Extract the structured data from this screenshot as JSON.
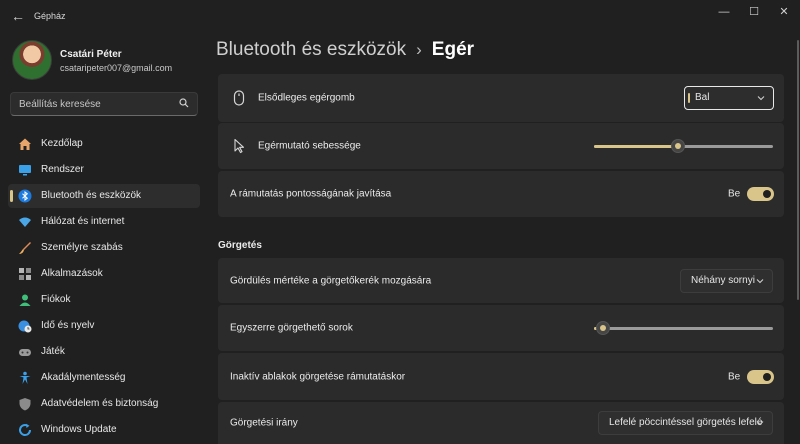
{
  "window": {
    "title": "Gépház",
    "back_label": "←",
    "minimize_label": "—",
    "maximize_label": "☐",
    "close_label": "✕"
  },
  "user": {
    "name": "Csatári Péter",
    "email": "csataripeter007@gmail.com"
  },
  "search": {
    "placeholder": "Beállítás keresése"
  },
  "sidebar": {
    "items": [
      {
        "label": "Kezdőlap",
        "icon": "home-icon"
      },
      {
        "label": "Rendszer",
        "icon": "monitor-icon"
      },
      {
        "label": "Bluetooth és eszközök",
        "icon": "bluetooth-icon",
        "active": true
      },
      {
        "label": "Hálózat és internet",
        "icon": "wifi-icon"
      },
      {
        "label": "Személyre szabás",
        "icon": "brush-icon"
      },
      {
        "label": "Alkalmazások",
        "icon": "apps-icon"
      },
      {
        "label": "Fiókok",
        "icon": "person-icon"
      },
      {
        "label": "Idő és nyelv",
        "icon": "globe-clock-icon"
      },
      {
        "label": "Játék",
        "icon": "gamepad-icon"
      },
      {
        "label": "Akadálymentesség",
        "icon": "accessibility-icon"
      },
      {
        "label": "Adatvédelem és biztonság",
        "icon": "shield-icon"
      },
      {
        "label": "Windows Update",
        "icon": "update-icon"
      }
    ]
  },
  "breadcrumb": {
    "parent": "Bluetooth és eszközök",
    "separator": "›",
    "current": "Egér"
  },
  "settings": {
    "primary_button": {
      "label": "Elsődleges egérgomb",
      "value": "Bal"
    },
    "pointer_speed": {
      "label": "Egérmutató sebessége",
      "level": 0.47
    },
    "pointer_precision": {
      "label": "A rámutatás pontosságának javítása",
      "state": "Be"
    },
    "scroll_section_title": "Görgetés",
    "wheel_scroll": {
      "label": "Gördülés mértéke a görgetőkerék mozgására",
      "value": "Néhány sornyi"
    },
    "lines_to_scroll": {
      "label": "Egyszerre görgethető sorok",
      "level": 0.05
    },
    "inactive_scroll": {
      "label": "Inaktív ablakok görgetése rámutatáskor",
      "state": "Be"
    },
    "scroll_direction": {
      "label": "Görgetési irány",
      "value": "Lefelé pöccintéssel görgetés lefelé"
    }
  },
  "colors": {
    "accent": "#d9c48a",
    "background": "#202020",
    "card": "#2b2b2b"
  }
}
